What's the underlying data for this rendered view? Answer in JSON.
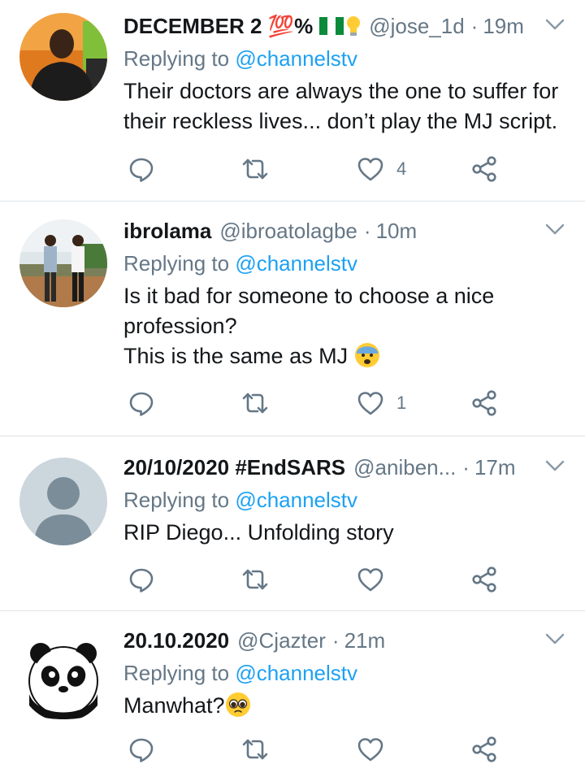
{
  "tweets": [
    {
      "name": "DECEMBER 2 💯%",
      "handle": "@jose_1d",
      "separator": "·",
      "time": "19m",
      "replying_prefix": "Replying to",
      "replying_to": "@channelstv",
      "text": "Their doctors are always the one to suffer for their reckless lives... don’t play the MJ script.",
      "like_count": "4"
    },
    {
      "name": "ibrolama",
      "handle": "@ibroatolagbe",
      "separator": "·",
      "time": "10m",
      "replying_prefix": "Replying to",
      "replying_to": "@channelstv",
      "text_line1": "Is it bad for someone to choose a nice profession?",
      "text_line2": "This is the same as MJ",
      "like_count": "1"
    },
    {
      "name": "20/10/2020 #EndSARS",
      "handle": "@aniben...",
      "separator": "·",
      "time": "17m",
      "replying_prefix": "Replying to",
      "replying_to": "@channelstv",
      "text": "RIP Diego... Unfolding story",
      "like_count": ""
    },
    {
      "name": "20.10.2020",
      "handle": "@Cjazter",
      "separator": "·",
      "time": "21m",
      "replying_prefix": "Replying to",
      "replying_to": "@channelstv",
      "text": "Manwhat?",
      "like_count": ""
    }
  ],
  "colors": {
    "link": "#1da1f2",
    "muted": "#657786",
    "text": "#14171a",
    "divider": "#dfe3e6"
  },
  "icons": [
    "reply-icon",
    "retweet-icon",
    "like-icon",
    "share-icon",
    "chevron-down-icon"
  ]
}
